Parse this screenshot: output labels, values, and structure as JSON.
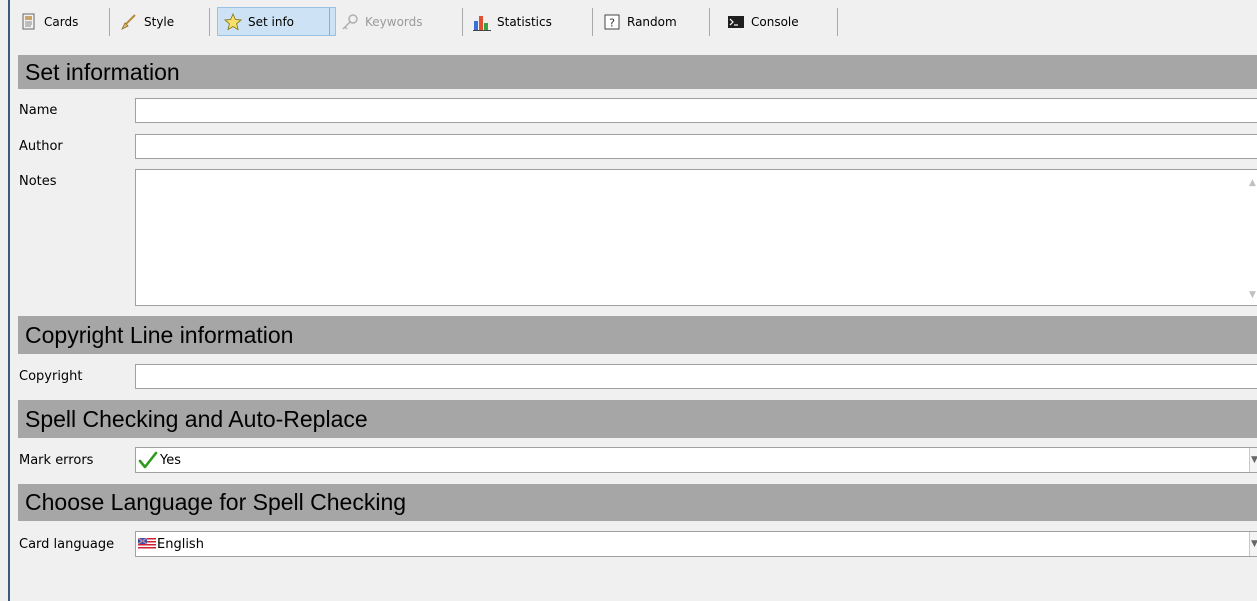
{
  "toolbar": {
    "tabs": [
      {
        "label": "Cards",
        "icon": "cards-icon"
      },
      {
        "label": "Style",
        "icon": "brush-icon"
      },
      {
        "label": "Set info",
        "icon": "star-icon"
      },
      {
        "label": "Keywords",
        "icon": "key-icon"
      },
      {
        "label": "Statistics",
        "icon": "bar-chart-icon"
      },
      {
        "label": "Random",
        "icon": "random-icon"
      },
      {
        "label": "Console",
        "icon": "console-icon"
      }
    ],
    "active_tab": "Set info",
    "disabled_tab": "Keywords"
  },
  "sections": {
    "set_info": {
      "title": "Set information",
      "name_label": "Name",
      "name_value": "",
      "author_label": "Author",
      "author_value": "",
      "notes_label": "Notes",
      "notes_value": ""
    },
    "copyright": {
      "title": "Copyright Line information",
      "copyright_label": "Copyright",
      "copyright_value": ""
    },
    "spell": {
      "title": "Spell Checking and Auto-Replace",
      "mark_errors_label": "Mark errors",
      "mark_errors_value": "Yes"
    },
    "language": {
      "title": "Choose Language for Spell Checking",
      "card_language_label": "Card language",
      "card_language_value": "English"
    }
  },
  "colors": {
    "section_header_bg": "#a6a6a6",
    "active_tab_bg": "#cde3f5",
    "check_green": "#2e9a1e"
  }
}
